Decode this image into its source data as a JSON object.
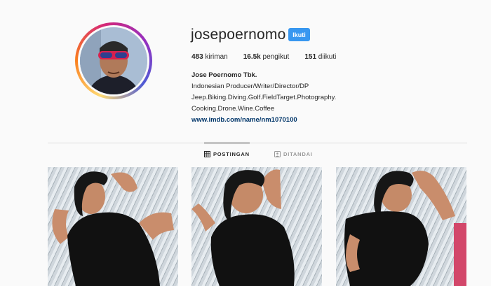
{
  "profile": {
    "username": "josepoernomo",
    "follow_label": "Ikuti",
    "stats": {
      "posts": "483",
      "posts_label": "kiriman",
      "followers": "16.5k",
      "followers_label": "pengikut",
      "following": "151",
      "following_label": "diikuti"
    },
    "bio": {
      "name": "Jose Poernomo Tbk.",
      "line1": "Indonesian Producer/Writer/Director/DP",
      "line2": "Jeep.Biking.Diving.Golf.FieldTarget.Photography.",
      "line3": "Cooking.Drone.Wine.Coffee",
      "link": "www.imdb.com/name/nm1070100"
    }
  },
  "tabs": [
    {
      "label": "POSTINGAN",
      "icon": "grid-icon",
      "active": true
    },
    {
      "label": "DITANDAI",
      "icon": "tag-icon",
      "active": false
    }
  ],
  "posts": [
    {
      "type": "photo"
    },
    {
      "type": "photo"
    },
    {
      "type": "photo"
    }
  ],
  "colors": {
    "accent": "#3897f0",
    "link": "#003569",
    "background": "#fafafa",
    "divider": "#dbdbdb"
  }
}
